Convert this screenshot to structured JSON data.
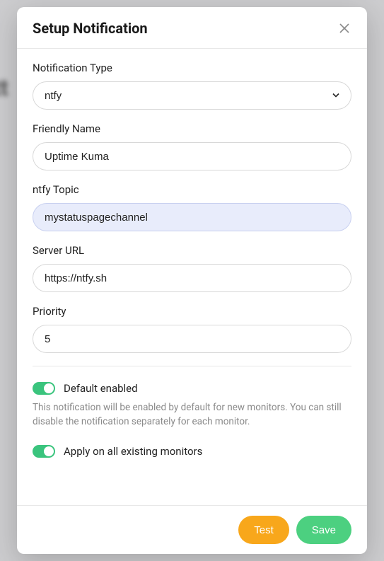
{
  "modal": {
    "title": "Setup Notification"
  },
  "form": {
    "notification_type": {
      "label": "Notification Type",
      "value": "ntfy"
    },
    "friendly_name": {
      "label": "Friendly Name",
      "value": "Uptime Kuma"
    },
    "ntfy_topic": {
      "label": "ntfy Topic",
      "value": "mystatuspagechannel"
    },
    "server_url": {
      "label": "Server URL",
      "value": "https://ntfy.sh"
    },
    "priority": {
      "label": "Priority",
      "value": "5"
    }
  },
  "toggles": {
    "default_enabled": {
      "label": "Default enabled",
      "desc": "This notification will be enabled by default for new monitors. You can still disable the notification separately for each monitor.",
      "on": true
    },
    "apply_all": {
      "label": "Apply on all existing monitors",
      "on": true
    }
  },
  "buttons": {
    "test": "Test",
    "save": "Save"
  },
  "colors": {
    "accent_green": "#4cd080",
    "accent_orange": "#f8a71b"
  }
}
